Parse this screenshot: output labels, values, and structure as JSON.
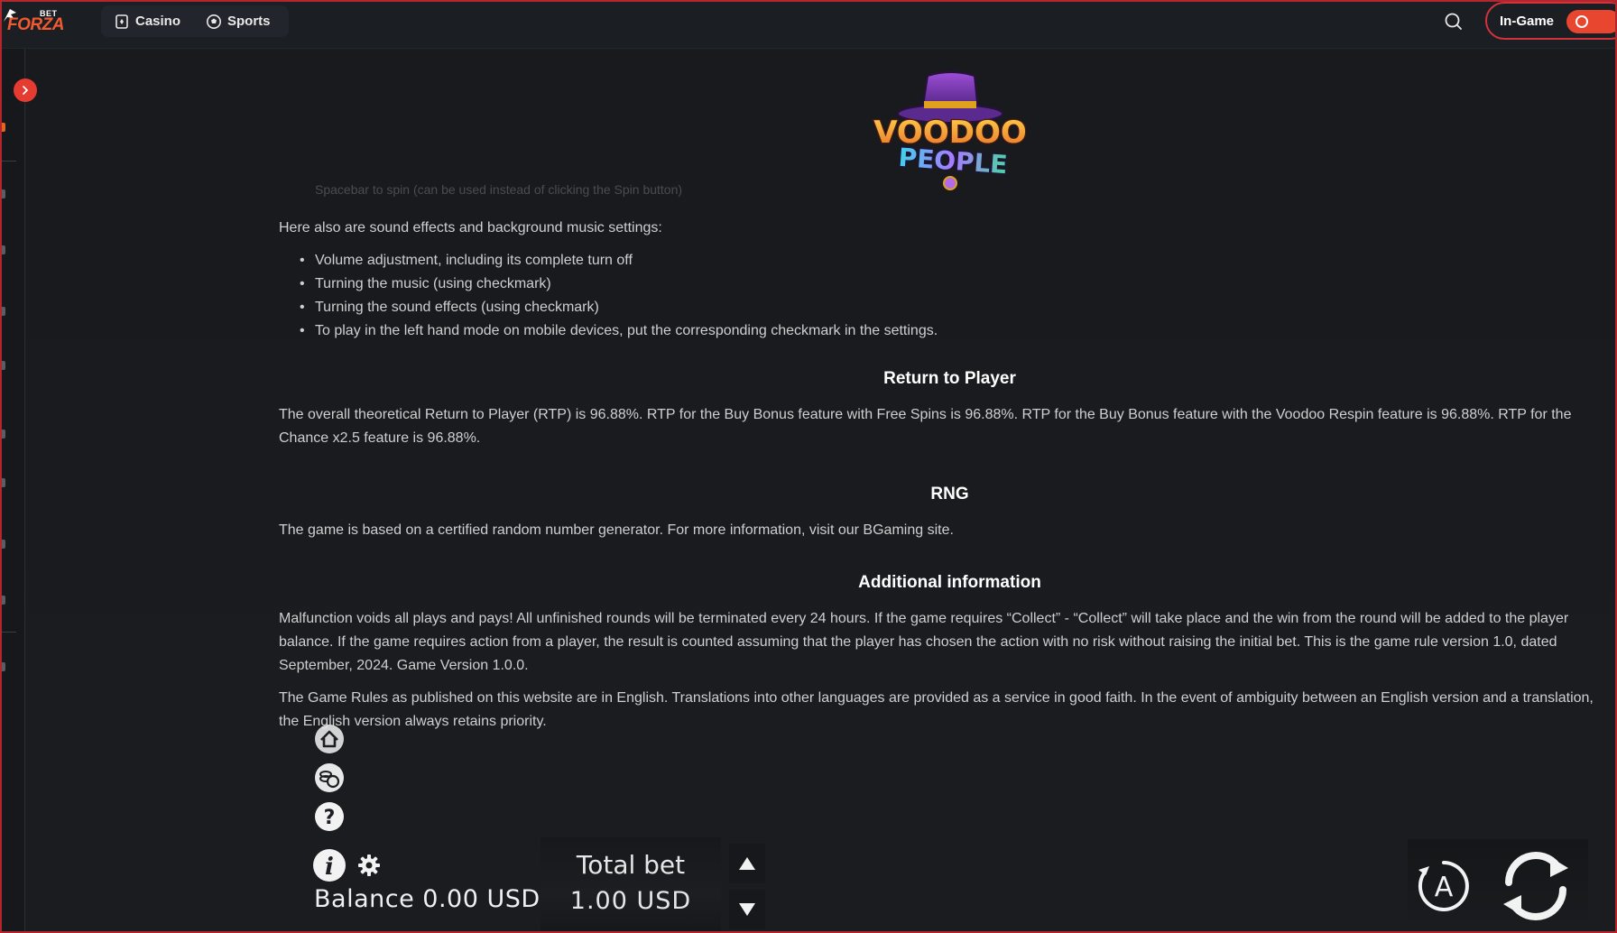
{
  "header": {
    "logo": {
      "small": "BET",
      "main": "FORZA"
    },
    "nav": [
      {
        "label": "Casino",
        "icon": "casino-icon"
      },
      {
        "label": "Sports",
        "icon": "soccer-ball-icon"
      }
    ],
    "in_game_label": "In-Game",
    "accent": "#e63b30"
  },
  "game": {
    "logo_line1": "VOODOO",
    "logo_line2": "PEOPLE",
    "faded_line": "Spacebar to spin (can be used instead of clicking the Spin button)",
    "sound_intro": "Here also are sound effects and background music settings:",
    "sound_items": [
      "Volume adjustment, including its complete turn off",
      "Turning the music (using checkmark)",
      "Turning the sound effects (using checkmark)",
      "To play in the left hand mode on mobile devices, put the corresponding checkmark in the settings."
    ],
    "rtp_title": "Return to Player",
    "rtp_text": "The overall theoretical Return to Player (RTP) is 96.88%. RTP for the Buy Bonus feature with Free Spins is 96.88%. RTP for the Buy Bonus feature with the Voodoo Respin feature is 96.88%. RTP for the Chance x2.5 feature is 96.88%.",
    "rng_title": "RNG",
    "rng_text": "The game is based on a certified random number generator. For more information, visit our BGaming site.",
    "additional_title": "Additional information",
    "additional_text": "Malfunction voids all plays and pays! All unfinished rounds will be terminated every 24 hours. If the game requires “Collect” - “Collect” will take place and the win from the round will be added to the player balance. If the game requires action from a player, the result is counted assuming that the player has chosen the action with no risk without raising the initial bet. This is the game rule version 1.0, dated September, 2024. Game Version 1.0.0.",
    "language_text": "The Game Rules as published on this website are in English. Translations into other languages are provided as a service in good faith. In the event of ambiguity between an English version and a translation, the English version always retains priority."
  },
  "controls": {
    "balance": "Balance 0.00 USD",
    "total_bet_label": "Total bet",
    "total_bet_value": "1.00 USD",
    "auto_label": "A",
    "icons": [
      "home-icon",
      "coins-icon",
      "help-icon",
      "info-icon",
      "gear-icon",
      "arrow-up-icon",
      "arrow-down-icon",
      "autoplay-icon",
      "spin-icon"
    ]
  }
}
